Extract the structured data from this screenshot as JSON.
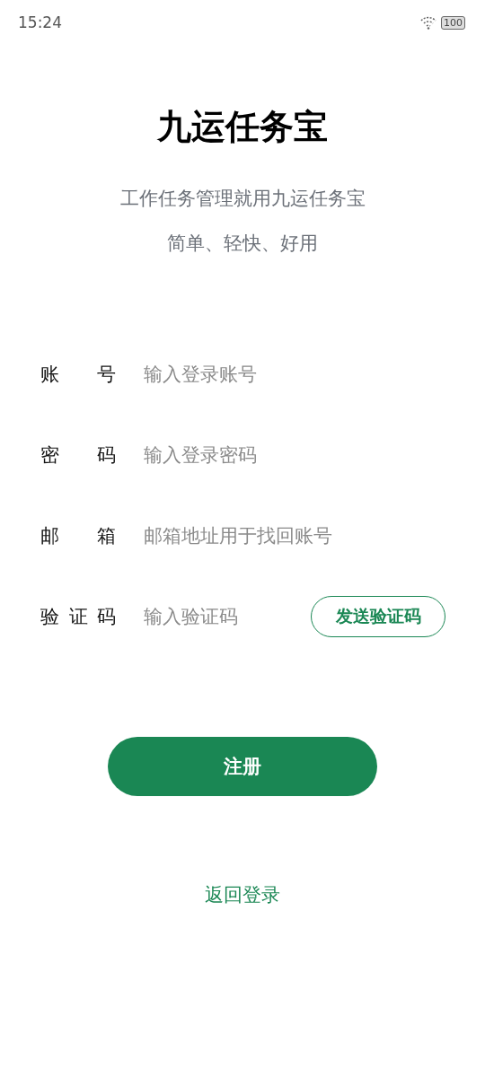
{
  "status_bar": {
    "time": "15:24",
    "battery": "100"
  },
  "title": "九运任务宝",
  "subtitle_lines": [
    "工作任务管理就用九运任务宝",
    "简单、轻快、好用"
  ],
  "fields": [
    {
      "label": "账号",
      "placeholder": "输入登录账号"
    },
    {
      "label": "密码",
      "placeholder": "输入登录密码"
    },
    {
      "label": "邮箱",
      "placeholder": "邮箱地址用于找回账号"
    },
    {
      "label": "验证码",
      "placeholder": "输入验证码",
      "button": "发送验证码"
    }
  ],
  "register_button": "注册",
  "back_link": "返回登录"
}
